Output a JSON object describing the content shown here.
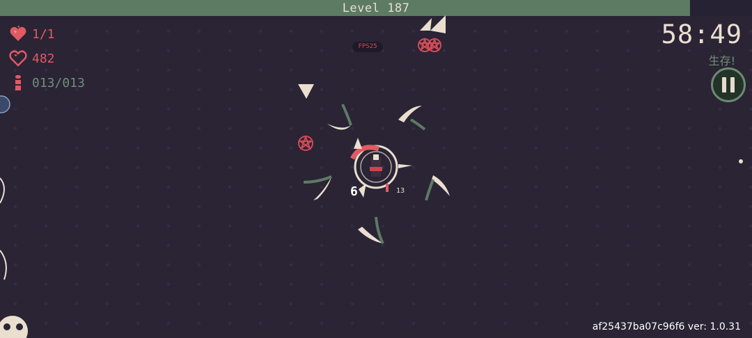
{
  "hud": {
    "level_label": "Level  187",
    "level_progress": 0.918,
    "hearts": "1/1",
    "souls": "482",
    "ammo": "013/013",
    "fps": "FPS25",
    "timer": "58:49",
    "mode_label": "生存!",
    "version": "af25437ba07c96f6 ver: 1.0.31"
  },
  "combat": {
    "damage_number": "6",
    "small_number": "13"
  },
  "colors": {
    "background": "#2a2435",
    "xp_fill": "#5d7a63",
    "hp_red": "#e05a63",
    "ammo_green": "#6f8f78",
    "cream": "#eadfcf"
  },
  "icons": {
    "hearts": "heart-icon",
    "souls": "soul-heart-icon",
    "ammo": "bullet-icon",
    "pause": "pause-icon"
  }
}
